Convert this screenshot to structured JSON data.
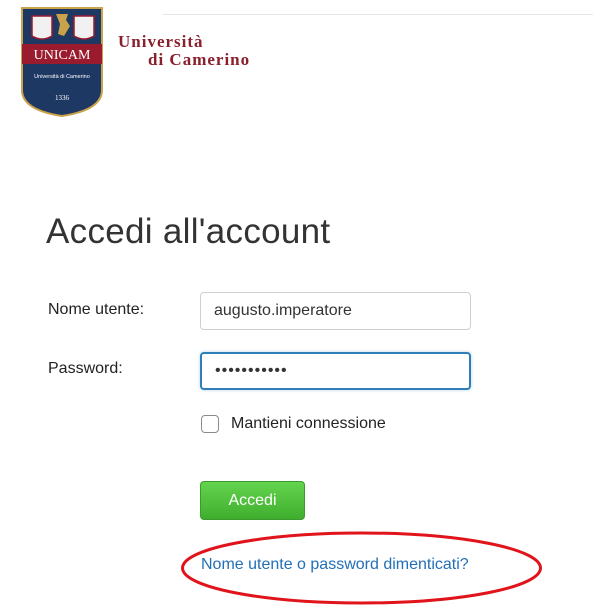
{
  "brand": {
    "crest_text": "UNICAM",
    "crest_subtext": "Università di Camerino",
    "crest_year": "1336",
    "wordmark_line1": "Università",
    "wordmark_line2": "di Camerino",
    "colors": {
      "crest": "#1e3864",
      "crest_band": "#9b1b2e",
      "wordmark": "#8a1f2d"
    }
  },
  "login": {
    "title": "Accedi all'account",
    "username_label": "Nome utente:",
    "username_value": "augusto.imperatore",
    "password_label": "Password:",
    "password_value": "•••••••••••",
    "remember_label": "Mantieni connessione",
    "remember_checked": false,
    "submit_label": "Accedi",
    "forgot_link": "Nome utente o password dimenticati?"
  },
  "colors": {
    "submit_button": "#4cbf3a",
    "link": "#2270b8",
    "focus_border": "#2e7fb8",
    "annotation_circle": "#e0141a"
  }
}
